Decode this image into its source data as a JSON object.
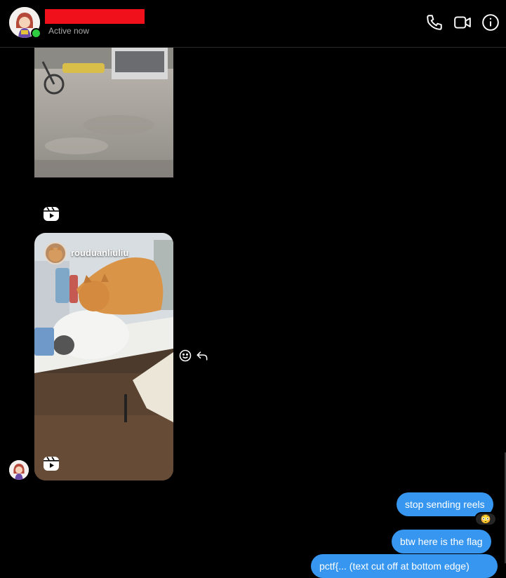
{
  "header": {
    "status": "Active now",
    "name_redacted_color": "#f0101c",
    "icons": [
      "phone-icon",
      "video-camera-icon",
      "info-icon"
    ]
  },
  "messages": {
    "reel": {
      "username": "rouduanliuliu"
    },
    "sent": [
      {
        "text": "stop sending reels",
        "reaction": "😳"
      },
      {
        "text": "btw here is the flag"
      },
      {
        "text": "pctf{... (text cut off at bottom edge)"
      }
    ]
  },
  "colors": {
    "bubble": "#3797f0",
    "online": "#2ecc40",
    "background": "#000000"
  }
}
